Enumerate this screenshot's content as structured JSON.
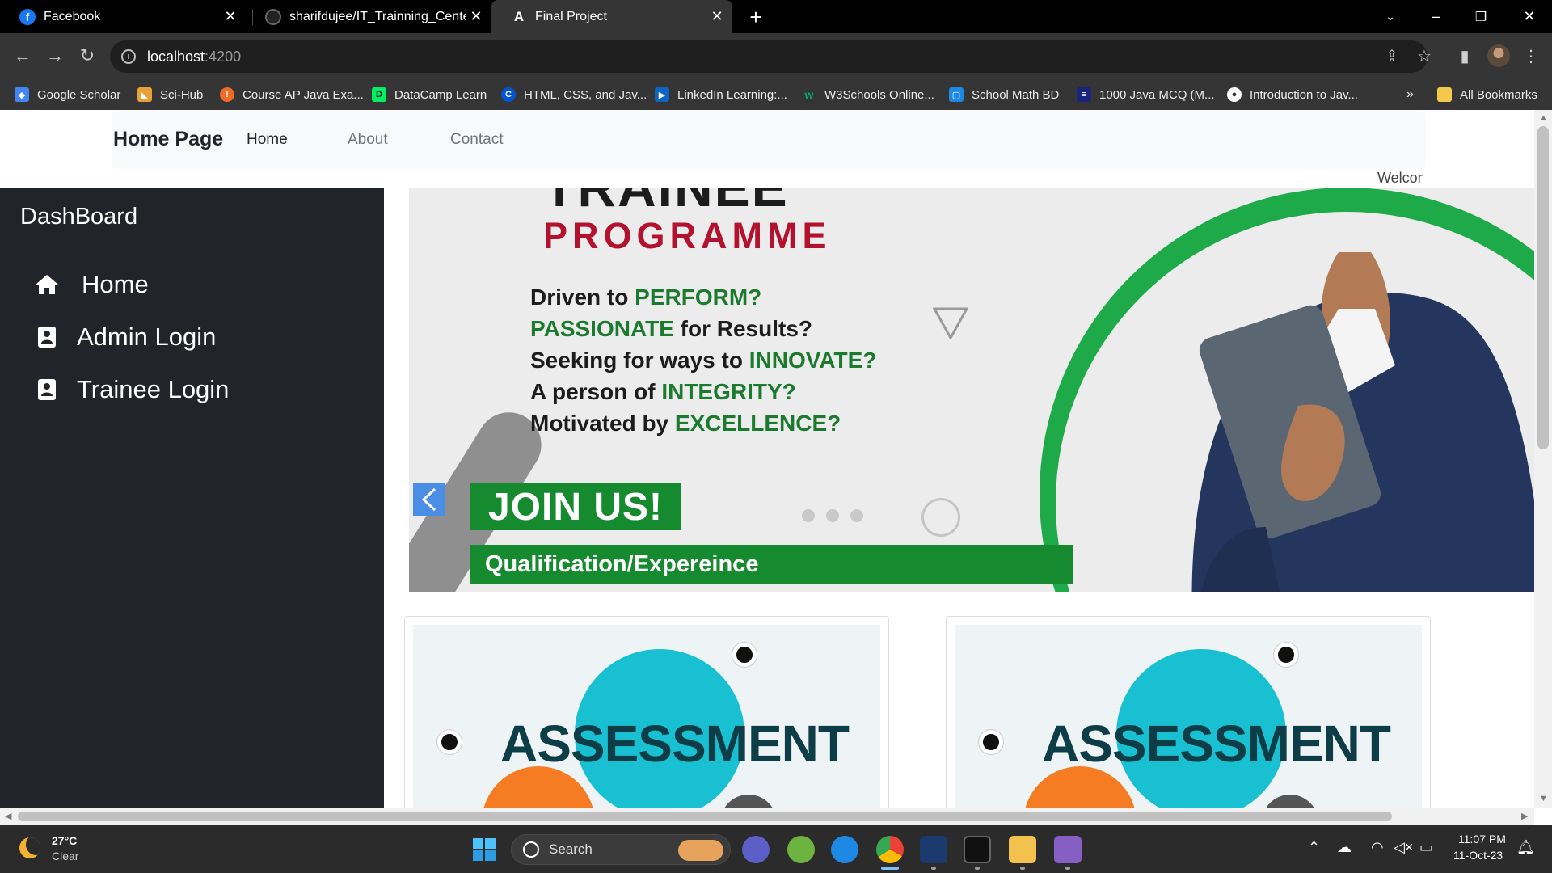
{
  "browser": {
    "tabs": [
      {
        "title": "Facebook",
        "favicon": "facebook-icon",
        "active": false
      },
      {
        "title": "sharifdujee/IT_Trainning_Center...",
        "favicon": "github-icon",
        "active": false
      },
      {
        "title": "Final Project",
        "favicon": "angular-icon",
        "active": true
      }
    ],
    "address": {
      "host": "localhost",
      "port": ":4200"
    },
    "bookmarks": [
      {
        "label": "Google Scholar",
        "icon": "google-scholar-icon",
        "color": "#4285f4"
      },
      {
        "label": "Sci-Hub",
        "icon": "sci-hub-icon",
        "color": "#e8a13a"
      },
      {
        "label": "Course AP Java Exa...",
        "icon": "course-icon",
        "color": "#f06b26"
      },
      {
        "label": "DataCamp Learn",
        "icon": "datacamp-icon",
        "color": "#03ef62"
      },
      {
        "label": "HTML, CSS, and Jav...",
        "icon": "coursera-icon",
        "color": "#0056d2"
      },
      {
        "label": "LinkedIn Learning:...",
        "icon": "linkedin-learning-icon",
        "color": "#0a66c2"
      },
      {
        "label": "W3Schools Online...",
        "icon": "w3schools-icon",
        "color": "#04aa6d"
      },
      {
        "label": "School Math BD",
        "icon": "school-math-icon",
        "color": "#1e88e5"
      },
      {
        "label": "1000 Java MCQ (M...",
        "icon": "java-mcq-icon",
        "color": "#1a237e"
      },
      {
        "label": "Introduction to Jav...",
        "icon": "globe-icon",
        "color": "#ffffff"
      }
    ],
    "all_bookmarks": "All Bookmarks",
    "overflow": "»"
  },
  "page": {
    "brand": "Home Page",
    "nav": [
      {
        "label": "Home",
        "active": true
      },
      {
        "label": "About",
        "active": false
      },
      {
        "label": "Contact",
        "active": false
      }
    ],
    "welcome": "Welcome",
    "sidebar": {
      "title": "DashBoard",
      "items": [
        {
          "label": "Home",
          "icon": "home-icon"
        },
        {
          "label": "Admin Login",
          "icon": "contact-book-icon"
        },
        {
          "label": "Trainee Login",
          "icon": "contact-book-icon"
        }
      ]
    },
    "carousel": {
      "heading_top": "TRAINEE",
      "heading": "PROGRAMME",
      "questions": [
        {
          "pre": "Driven to ",
          "highlight": "PERFORM?",
          "post": ""
        },
        {
          "pre": "",
          "highlight": "PASSIONATE",
          "post": " for Results?"
        },
        {
          "pre": "Seeking for ways to ",
          "highlight": "INNOVATE?",
          "post": ""
        },
        {
          "pre": "A person of ",
          "highlight": "INTEGRITY?",
          "post": ""
        },
        {
          "pre": "Motivated by ",
          "highlight": "EXCELLENCE?",
          "post": ""
        }
      ],
      "cta": "JOIN US!",
      "bar": "Qualification/Expereince",
      "prev_icon": "chevron-left-icon"
    },
    "cards": [
      {
        "image_text": "ASSESSMENT"
      },
      {
        "image_text": "ASSESSMENT"
      }
    ]
  },
  "taskbar": {
    "weather": {
      "temp": "27°C",
      "condition": "Clear"
    },
    "search_label": "Search",
    "time": "11:07 PM",
    "date": "11-Oct-23"
  }
}
